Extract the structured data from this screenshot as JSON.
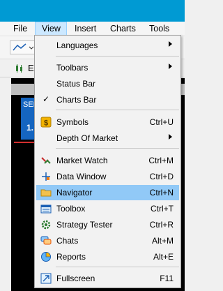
{
  "menubar": {
    "items": [
      {
        "label": "File"
      },
      {
        "label": "View"
      },
      {
        "label": "Insert"
      },
      {
        "label": "Charts"
      },
      {
        "label": "Tools"
      }
    ]
  },
  "tabstrip": {
    "label": "E"
  },
  "chart": {
    "sell_label": "SEL",
    "price": "1."
  },
  "view_menu": {
    "items": [
      {
        "label": "Languages",
        "submenu": true
      },
      {
        "label": "Toolbars",
        "submenu": true
      },
      {
        "label": "Status Bar"
      },
      {
        "label": "Charts Bar",
        "checked": true
      },
      {
        "label": "Symbols",
        "shortcut": "Ctrl+U",
        "icon": "dollar-icon"
      },
      {
        "label": "Depth Of Market",
        "submenu": true
      },
      {
        "label": "Market Watch",
        "shortcut": "Ctrl+M",
        "icon": "market-watch-icon"
      },
      {
        "label": "Data Window",
        "shortcut": "Ctrl+D",
        "icon": "crosshair-icon"
      },
      {
        "label": "Navigator",
        "shortcut": "Ctrl+N",
        "icon": "folder-icon",
        "highlighted": true
      },
      {
        "label": "Toolbox",
        "shortcut": "Ctrl+T",
        "icon": "toolbox-icon"
      },
      {
        "label": "Strategy Tester",
        "shortcut": "Ctrl+R",
        "icon": "gear-icon"
      },
      {
        "label": "Chats",
        "shortcut": "Alt+M",
        "icon": "chat-icon"
      },
      {
        "label": "Reports",
        "shortcut": "Alt+E",
        "icon": "pie-chart-icon"
      },
      {
        "label": "Fullscreen",
        "shortcut": "F11",
        "icon": "fullscreen-icon"
      }
    ]
  }
}
